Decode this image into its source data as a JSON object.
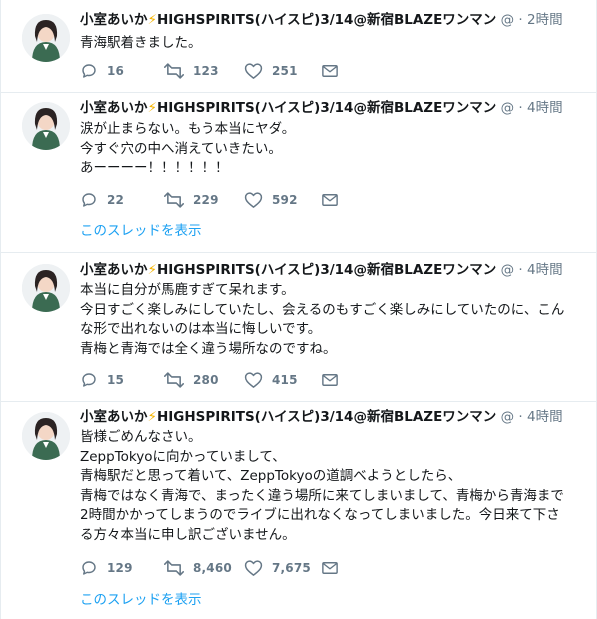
{
  "user": {
    "name": "小室あいか",
    "bolt": "⚡",
    "suffix": "HIGHSPIRITS(ハイスピ)3/14@新宿BLAZEワンマン",
    "handle": "@"
  },
  "tweets": [
    {
      "time": "2時間",
      "lines": [
        "青海駅着きました。"
      ],
      "replies": "16",
      "retweets": "123",
      "likes": "251"
    },
    {
      "time": "4時間",
      "lines": [
        "涙が止まらない。もう本当にヤダ。",
        "今すぐ穴の中へ消えていきたい。",
        "あーーーー！！！！！！"
      ],
      "replies": "22",
      "retweets": "229",
      "likes": "592",
      "thread_link": "このスレッドを表示"
    },
    {
      "time": "4時間",
      "lines": [
        "本当に自分が馬鹿すぎて呆れます。",
        "今日すごく楽しみにしていたし、会えるのもすごく楽しみにしていたのに、こん",
        "な形で出れないのは本当に悔しいです。",
        "青梅と青海では全く違う場所なのですね。"
      ],
      "replies": "15",
      "retweets": "280",
      "likes": "415"
    },
    {
      "time": "4時間",
      "lines": [
        "皆様ごめんなさい。",
        "ZeppTokyoに向かっていまして、",
        "青梅駅だと思って着いて、ZeppTokyoの道調べようとしたら、",
        "青梅ではなく青海で、まったく違う場所に来てしまいまして、青梅から青海まで",
        "2時間かかってしまうのでライブに出れなくなってしまいました。今日来て下さ",
        "る方々本当に申し訳ございません。"
      ],
      "replies": "129",
      "retweets": "8,460",
      "likes": "7,675",
      "thread_link": "このスレッドを表示"
    }
  ],
  "colors": {
    "text": "#14171a",
    "secondary": "#657786",
    "link": "#1da1f2",
    "border": "#e6ecf0",
    "bolt": "#f5b400"
  },
  "icons": [
    "reply-icon",
    "retweet-icon",
    "like-icon",
    "direct-message-icon",
    "avatar"
  ]
}
